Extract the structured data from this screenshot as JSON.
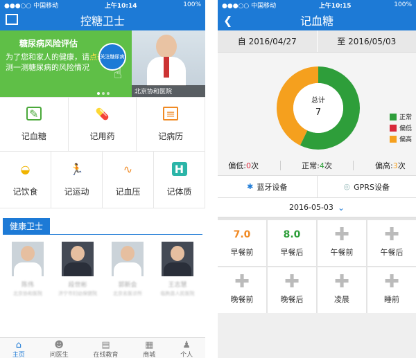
{
  "status_left": {
    "carrier": "●●●○○ 中国移动",
    "wifi": "≋",
    "time": "上午10:14",
    "battery": "100%"
  },
  "status_right": {
    "carrier": "●●●○○ 中国移动",
    "wifi": "≋",
    "time": "上午10:15",
    "battery": "100%"
  },
  "left": {
    "title": "控糖卫士",
    "banner": {
      "title": "糖尿病风险评估",
      "text_pre": "为了您和家人的健康，请",
      "text_link": "点击",
      "text_post": "这里测一测糖尿病的风险情况",
      "badge": "关注糖尿病",
      "photo_caption": "北京协和医院"
    },
    "features_row1": [
      {
        "label": "记血糖",
        "icon": "pen-icon"
      },
      {
        "label": "记用药",
        "icon": "pill-icon"
      },
      {
        "label": "记病历",
        "icon": "record-icon"
      }
    ],
    "features_row2": [
      {
        "label": "记饮食",
        "icon": "bowl-icon"
      },
      {
        "label": "记运动",
        "icon": "running-icon"
      },
      {
        "label": "记血压",
        "icon": "blood-pressure-icon"
      },
      {
        "label": "记体质",
        "icon": "health-h-icon"
      }
    ],
    "section_title": "健康卫士",
    "doctors": [
      {
        "name": "陈伟",
        "sub": "北京协和医院"
      },
      {
        "name": "段世彬",
        "sub": "济宁市妇幼保健院"
      },
      {
        "name": "郭新会",
        "sub": "北京名医诊所"
      },
      {
        "name": "王志慧",
        "sub": "临朐县人民医院"
      }
    ],
    "tabs": [
      "主页",
      "问医生",
      "在线教育",
      "商城",
      "个人"
    ]
  },
  "right": {
    "title": "记血糖",
    "date_from": "自 2016/04/27",
    "date_to": "至 2016/05/03",
    "total_label": "总计",
    "total_value": "7",
    "counts": {
      "low_label": "偏低:",
      "low_value": "0",
      "normal_label": "正常:",
      "normal_value": "4",
      "high_label": "偏高:",
      "high_value": "3",
      "unit": "次"
    },
    "devices": {
      "bluetooth": "蓝牙设备",
      "gprs": "GPRS设备"
    },
    "selected_date": "2016-05-03",
    "readings": [
      {
        "label": "早餐前",
        "value": "7.0",
        "color": "#f08a24"
      },
      {
        "label": "早餐后",
        "value": "8.0",
        "color": "#2e9e3a"
      },
      {
        "label": "午餐前",
        "value": ""
      },
      {
        "label": "午餐后",
        "value": ""
      },
      {
        "label": "晚餐前",
        "value": ""
      },
      {
        "label": "晚餐后",
        "value": ""
      },
      {
        "label": "凌晨",
        "value": ""
      },
      {
        "label": "睡前",
        "value": ""
      }
    ]
  },
  "chart_data": {
    "type": "pie",
    "categories": [
      "正常",
      "偏低",
      "偏高"
    ],
    "values": [
      4,
      0,
      3
    ],
    "colors": [
      "#2e9e3a",
      "#d8283a",
      "#f5a01e"
    ],
    "legend_position": "bottom-right"
  }
}
